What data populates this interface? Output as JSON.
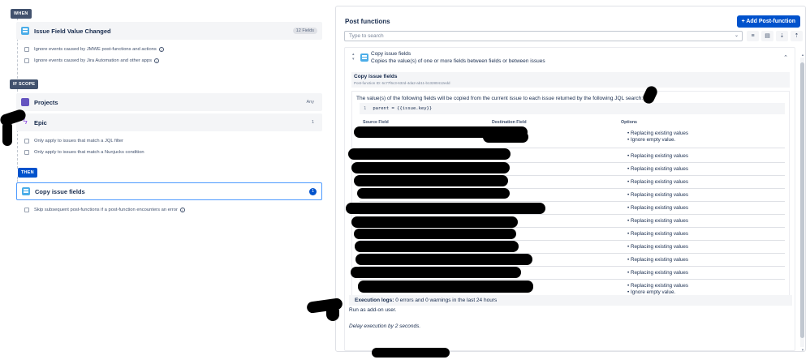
{
  "left": {
    "when_label": "WHEN",
    "trigger": {
      "title": "Issue Field Value Changed",
      "badge": "12 Fields"
    },
    "trigger_options": [
      "Ignore events caused by JMWE post-functions and actions",
      "Ignore events caused by Jira Automation and other apps"
    ],
    "if_scope_label": "IF SCOPE",
    "scope_projects": {
      "title": "Projects",
      "badge": "Any"
    },
    "scope_epic": {
      "title": "Epic",
      "badge": "1"
    },
    "scope_options": [
      "Only apply to issues that match a JQL filter",
      "Only apply to issues that match a Nunjucks condition"
    ],
    "then_label": "THEN",
    "action": {
      "title": "Copy issue fields",
      "badge": "1"
    },
    "action_option": "Skip subsequent post-functions if a post-function encounters an error"
  },
  "panel": {
    "title": "Post functions",
    "add_button": "+ Add Post-function",
    "search_placeholder": "Type to search",
    "card": {
      "name": "Copy issue fields",
      "description": "Copies the value(s) of one or more fields between fields or between issues",
      "sub_title": "Copy issue fields",
      "sub_id": "Post-function ID: 6c77f6c3-632d-4da2-ab11-b13280412edd",
      "value_text": "The value(s) of the following fields will be copied from the current issue to each issue returned by the following JQL search:",
      "code_line_number": "1",
      "code": "parent = {{issue.key}}",
      "columns": [
        "Source Field",
        "Destination Field",
        "Options"
      ],
      "rows": [
        [
          "Replacing existing values",
          "Ignore empty value."
        ],
        [
          "Replacing existing values"
        ],
        [
          "Replacing existing values"
        ],
        [
          "Replacing existing values"
        ],
        [
          "Replacing existing values"
        ],
        [
          "Replacing existing values"
        ],
        [
          "Replacing existing values"
        ],
        [
          "Replacing existing values"
        ],
        [
          "Replacing existing values"
        ],
        [
          "Replacing existing values"
        ],
        [
          "Replacing existing values"
        ],
        [
          "Replacing existing values",
          "Ignore empty value."
        ]
      ],
      "run_as": "Run as add-on user.",
      "delay": "Delay execution by 2 seconds.",
      "exec_label": "Execution logs:",
      "exec_text": " 0 errors and 0 warnings in the last 24 hours"
    }
  }
}
